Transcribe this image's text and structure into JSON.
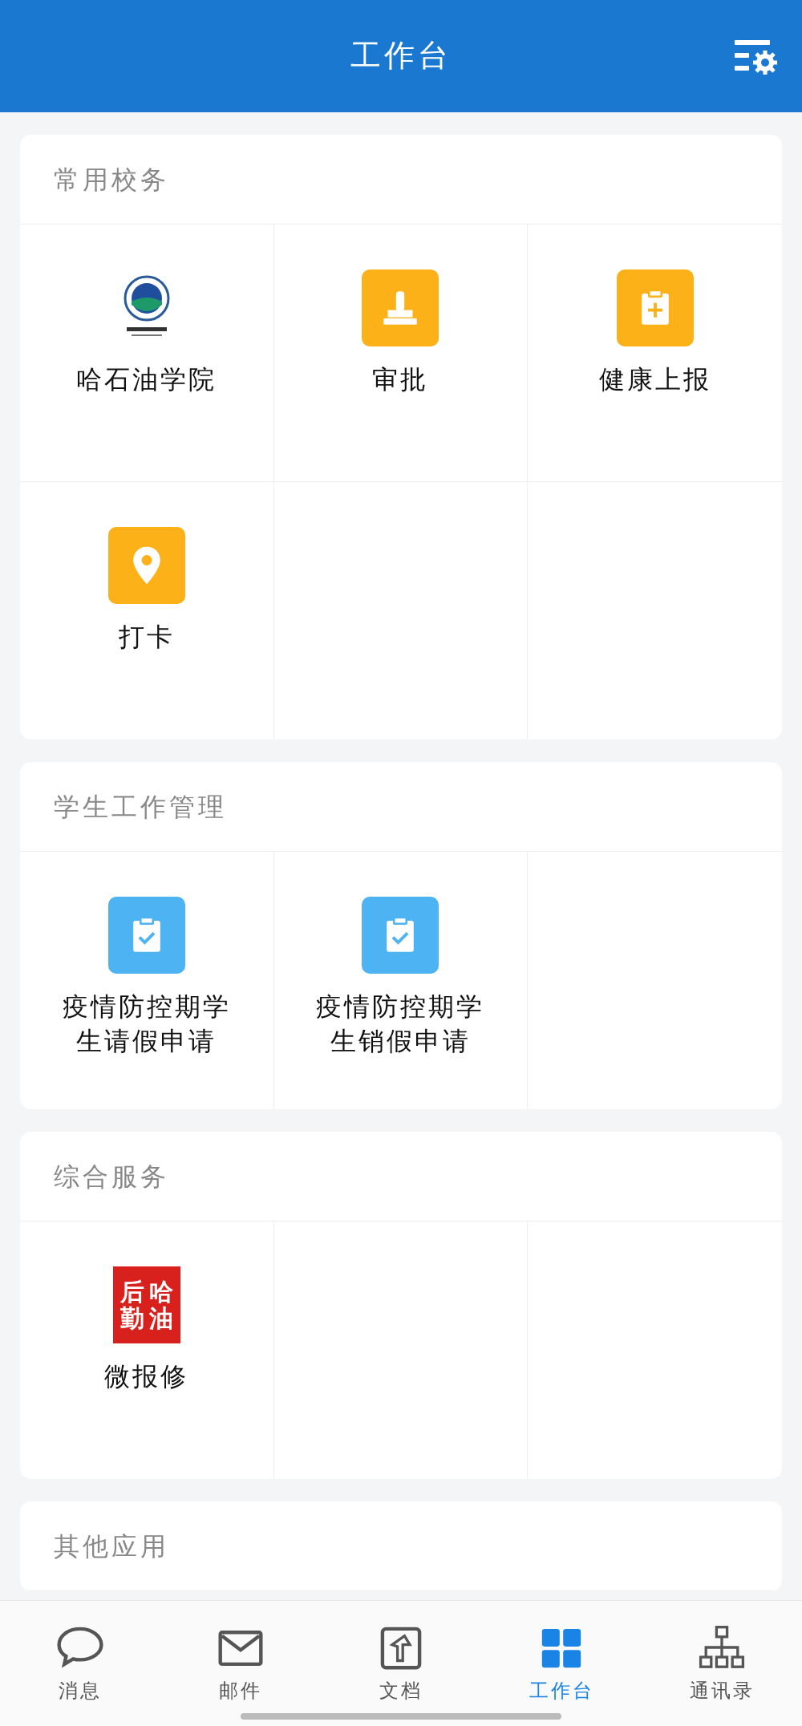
{
  "header": {
    "title": "工作台"
  },
  "sections": [
    {
      "title": "常用校务",
      "items": [
        {
          "label": "哈石油学院",
          "kind": "logo"
        },
        {
          "label": "审批",
          "kind": "stamp"
        },
        {
          "label": "健康上报",
          "kind": "clipboard-plus"
        },
        {
          "label": "打卡",
          "kind": "location"
        }
      ]
    },
    {
      "title": "学生工作管理",
      "items": [
        {
          "label": "疫情防控期学生请假申请",
          "kind": "clipboard-check"
        },
        {
          "label": "疫情防控期学生销假申请",
          "kind": "clipboard-check"
        }
      ]
    },
    {
      "title": "综合服务",
      "items": [
        {
          "label": "微报修",
          "kind": "seal",
          "seal_text": [
            "后",
            "哈",
            "勤",
            "油"
          ]
        }
      ]
    },
    {
      "title": "其他应用"
    }
  ],
  "tabbar": [
    {
      "label": "消息",
      "kind": "chat",
      "selected": false
    },
    {
      "label": "邮件",
      "kind": "mail",
      "selected": false
    },
    {
      "label": "文档",
      "kind": "doc",
      "selected": false
    },
    {
      "label": "工作台",
      "kind": "grid",
      "selected": true
    },
    {
      "label": "通讯录",
      "kind": "org",
      "selected": false
    }
  ]
}
